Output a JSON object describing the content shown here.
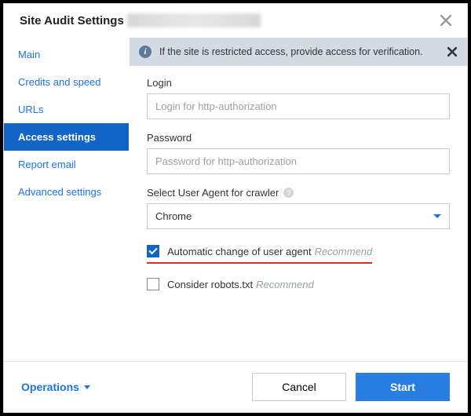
{
  "header": {
    "title": "Site Audit Settings"
  },
  "sidebar": {
    "items": [
      {
        "label": "Main"
      },
      {
        "label": "Credits and speed"
      },
      {
        "label": "URLs"
      },
      {
        "label": "Access settings"
      },
      {
        "label": "Report email"
      },
      {
        "label": "Advanced settings"
      }
    ],
    "active_index": 3
  },
  "banner": {
    "text": "If the site is restricted access, provide access for verification."
  },
  "form": {
    "login_label": "Login",
    "login_placeholder": "Login for http-authorization",
    "password_label": "Password",
    "password_placeholder": "Password for http-authorization",
    "ua_label": "Select User Agent for crawler",
    "ua_selected": "Chrome",
    "auto_change_label": "Automatic change of user agent",
    "auto_change_checked": true,
    "robots_label": "Consider robots.txt",
    "robots_checked": false,
    "recommend_text": "Recommend"
  },
  "footer": {
    "operations": "Operations",
    "cancel": "Cancel",
    "start": "Start"
  }
}
